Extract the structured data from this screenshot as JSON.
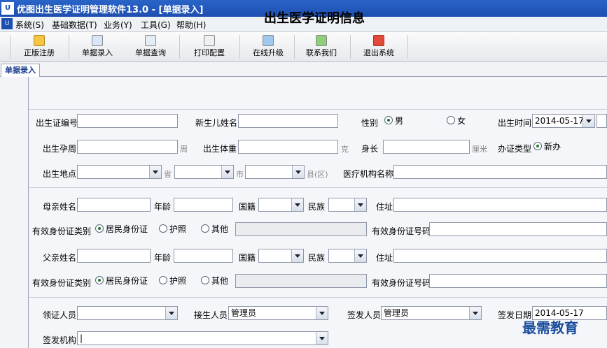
{
  "window": {
    "title": "优图出生医学证明管理软件13.0 - [单据录入]",
    "app_icon": "U"
  },
  "menu": [
    "系统(S)",
    "基础数据(T)",
    "业务(Y)",
    "工具(G)",
    "帮助(H)"
  ],
  "toolbar": [
    "正版注册",
    "单据录入",
    "单据查询",
    "打印配置",
    "在线升级",
    "联系我们",
    "退出系统"
  ],
  "tab": "单据录入",
  "form": {
    "title": "出生医学证明信息",
    "birth_cert_no": {
      "label": "出生证编号",
      "value": ""
    },
    "baby_name": {
      "label": "新生儿姓名",
      "value": ""
    },
    "sex": {
      "label": "性别",
      "options": [
        "男",
        "女"
      ],
      "selected": "男"
    },
    "birth_time": {
      "label": "出生时间",
      "value": "2014-05-17"
    },
    "gest_week": {
      "label": "出生孕周",
      "unit": "周",
      "value": ""
    },
    "weight": {
      "label": "出生体重",
      "unit": "克",
      "value": ""
    },
    "length": {
      "label": "身长",
      "unit": "厘米",
      "value": ""
    },
    "cert_type": {
      "label": "办证类型",
      "selected": "新办"
    },
    "birthplace": {
      "label": "出生地点",
      "unit_province": "省",
      "unit_city": "市",
      "unit_county": "县(区)"
    },
    "hospital": {
      "label": "医疗机构名称",
      "value": ""
    },
    "mother": {
      "name": "母亲姓名",
      "age": "年龄",
      "nationality": "国籍",
      "ethnicity": "民族",
      "address": "住址",
      "id_type": "有效身份证类别",
      "id_no": "有效身份证号码"
    },
    "father": {
      "name": "父亲姓名",
      "age": "年龄",
      "nationality": "国籍",
      "ethnicity": "民族",
      "address": "住址",
      "id_type": "有效身份证类别",
      "id_no": "有效身份证号码"
    },
    "id_options": [
      "居民身份证",
      "护照",
      "其他"
    ],
    "receiver": {
      "label": "领证人员",
      "value": ""
    },
    "deliverer": {
      "label": "接生人员",
      "value": "管理员"
    },
    "issuer": {
      "label": "签发人员",
      "value": "管理员"
    },
    "issue_date": {
      "label": "签发日期",
      "value": "2014-05-17"
    },
    "issue_org": {
      "label": "签发机构",
      "value": "|"
    }
  },
  "watermark": "最需教育"
}
